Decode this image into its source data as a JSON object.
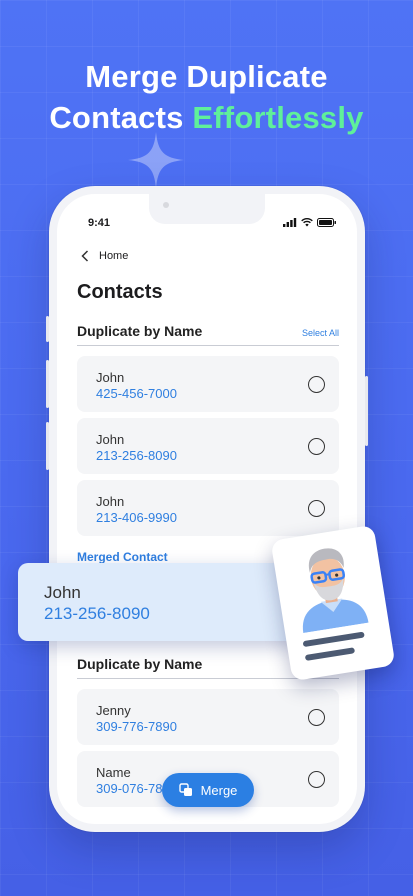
{
  "headline": {
    "line1": "Merge Duplicate",
    "line2_prefix": "Contacts ",
    "line2_accent": "Effortlessly"
  },
  "status_bar": {
    "time": "9:41"
  },
  "nav": {
    "back_label": "Home"
  },
  "page_title": "Contacts",
  "groups": [
    {
      "title": "Duplicate by Name",
      "action": "Select All",
      "contacts": [
        {
          "name": "John",
          "phone": "425-456-7000"
        },
        {
          "name": "John",
          "phone": "213-256-8090"
        },
        {
          "name": "John",
          "phone": "213-406-9990"
        }
      ]
    },
    {
      "title": "Duplicate by Name",
      "contacts": [
        {
          "name": "Jenny",
          "phone": "309-776-7890"
        },
        {
          "name": "Name",
          "phone": "309-076-78"
        }
      ]
    }
  ],
  "merged": {
    "label": "Merged Contact",
    "name": "John",
    "phone": "213-256-8090"
  },
  "merge_button": {
    "label": "Merge"
  },
  "colors": {
    "background": "#4f73f5",
    "accent_green": "#5ff09a",
    "link_blue": "#2f7fe0",
    "button_blue": "#2b7fe3"
  },
  "icons": [
    "sparkle-icon",
    "chevron-left-icon",
    "signal-icon",
    "wifi-icon",
    "battery-icon",
    "radio-icon",
    "merge-icon",
    "avatar-icon"
  ]
}
